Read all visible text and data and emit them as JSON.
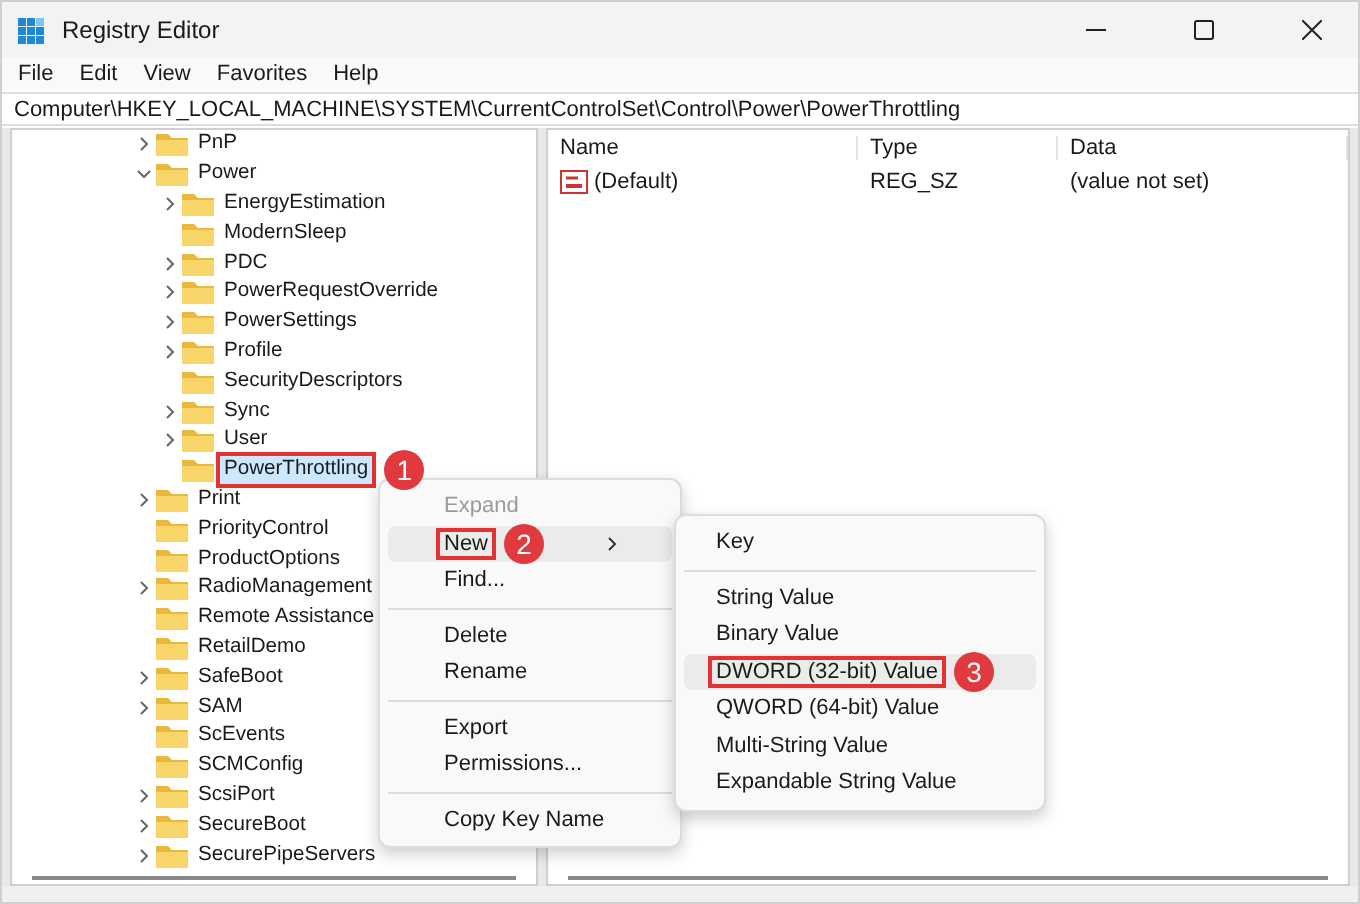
{
  "window": {
    "title": "Registry Editor"
  },
  "menu_bar": [
    "File",
    "Edit",
    "View",
    "Favorites",
    "Help"
  ],
  "address": "Computer\\HKEY_LOCAL_MACHINE\\SYSTEM\\CurrentControlSet\\Control\\Power\\PowerThrottling",
  "tree": [
    {
      "label": "PnP",
      "kind": "branch",
      "expanded": false,
      "selected": false
    },
    {
      "label": "Power",
      "kind": "branch",
      "expanded": true,
      "selected": false,
      "children": [
        {
          "label": "EnergyEstimation",
          "kind": "branch",
          "expanded": false,
          "selected": false
        },
        {
          "label": "ModernSleep",
          "kind": "leaf",
          "selected": false
        },
        {
          "label": "PDC",
          "kind": "branch",
          "expanded": false,
          "selected": false
        },
        {
          "label": "PowerRequestOverride",
          "kind": "branch",
          "expanded": false,
          "selected": false
        },
        {
          "label": "PowerSettings",
          "kind": "branch",
          "expanded": false,
          "selected": false
        },
        {
          "label": "Profile",
          "kind": "branch",
          "expanded": false,
          "selected": false
        },
        {
          "label": "SecurityDescriptors",
          "kind": "leaf",
          "selected": false
        },
        {
          "label": "Sync",
          "kind": "branch",
          "expanded": false,
          "selected": false
        },
        {
          "label": "User",
          "kind": "branch",
          "expanded": false,
          "selected": false
        },
        {
          "label": "PowerThrottling",
          "kind": "leaf",
          "selected": true,
          "callout": "1"
        }
      ]
    },
    {
      "label": "Print",
      "kind": "branch",
      "expanded": false,
      "selected": false
    },
    {
      "label": "PriorityControl",
      "kind": "leaf",
      "selected": false
    },
    {
      "label": "ProductOptions",
      "kind": "leaf",
      "selected": false
    },
    {
      "label": "RadioManagement",
      "kind": "branch",
      "expanded": false,
      "selected": false
    },
    {
      "label": "Remote Assistance",
      "kind": "leaf",
      "selected": false
    },
    {
      "label": "RetailDemo",
      "kind": "leaf",
      "selected": false
    },
    {
      "label": "SafeBoot",
      "kind": "branch",
      "expanded": false,
      "selected": false
    },
    {
      "label": "SAM",
      "kind": "branch",
      "expanded": false,
      "selected": false
    },
    {
      "label": "ScEvents",
      "kind": "leaf",
      "selected": false
    },
    {
      "label": "SCMConfig",
      "kind": "leaf",
      "selected": false
    },
    {
      "label": "ScsiPort",
      "kind": "branch",
      "expanded": false,
      "selected": false
    },
    {
      "label": "SecureBoot",
      "kind": "branch",
      "expanded": false,
      "selected": false
    },
    {
      "label": "SecurePipeServers",
      "kind": "branch",
      "expanded": false,
      "selected": false
    }
  ],
  "values_table": {
    "columns": [
      "Name",
      "Type",
      "Data"
    ],
    "rows": [
      {
        "name": "(Default)",
        "type": "REG_SZ",
        "data": "(value not set)"
      }
    ]
  },
  "context_menu": [
    {
      "kind": "item",
      "label": "Expand",
      "disabled": true,
      "selected": false
    },
    {
      "kind": "item",
      "label": "New",
      "disabled": false,
      "selected": true,
      "submenu": true,
      "callout": "2"
    },
    {
      "kind": "item",
      "label": "Find...",
      "disabled": false,
      "selected": false
    },
    {
      "kind": "separator"
    },
    {
      "kind": "item",
      "label": "Delete",
      "disabled": false,
      "selected": false
    },
    {
      "kind": "item",
      "label": "Rename",
      "disabled": false,
      "selected": false
    },
    {
      "kind": "separator"
    },
    {
      "kind": "item",
      "label": "Export",
      "disabled": false,
      "selected": false
    },
    {
      "kind": "item",
      "label": "Permissions...",
      "disabled": false,
      "selected": false
    },
    {
      "kind": "separator"
    },
    {
      "kind": "item",
      "label": "Copy Key Name",
      "disabled": false,
      "selected": false
    }
  ],
  "submenu": [
    {
      "kind": "item",
      "label": "Key",
      "selected": false
    },
    {
      "kind": "separator"
    },
    {
      "kind": "item",
      "label": "String Value",
      "selected": false
    },
    {
      "kind": "item",
      "label": "Binary Value",
      "selected": false
    },
    {
      "kind": "item",
      "label": "DWORD (32-bit) Value",
      "selected": true,
      "callout": "3"
    },
    {
      "kind": "item",
      "label": "QWORD (64-bit) Value",
      "selected": false
    },
    {
      "kind": "item",
      "label": "Multi-String Value",
      "selected": false
    },
    {
      "kind": "item",
      "label": "Expandable String Value",
      "selected": false
    }
  ]
}
